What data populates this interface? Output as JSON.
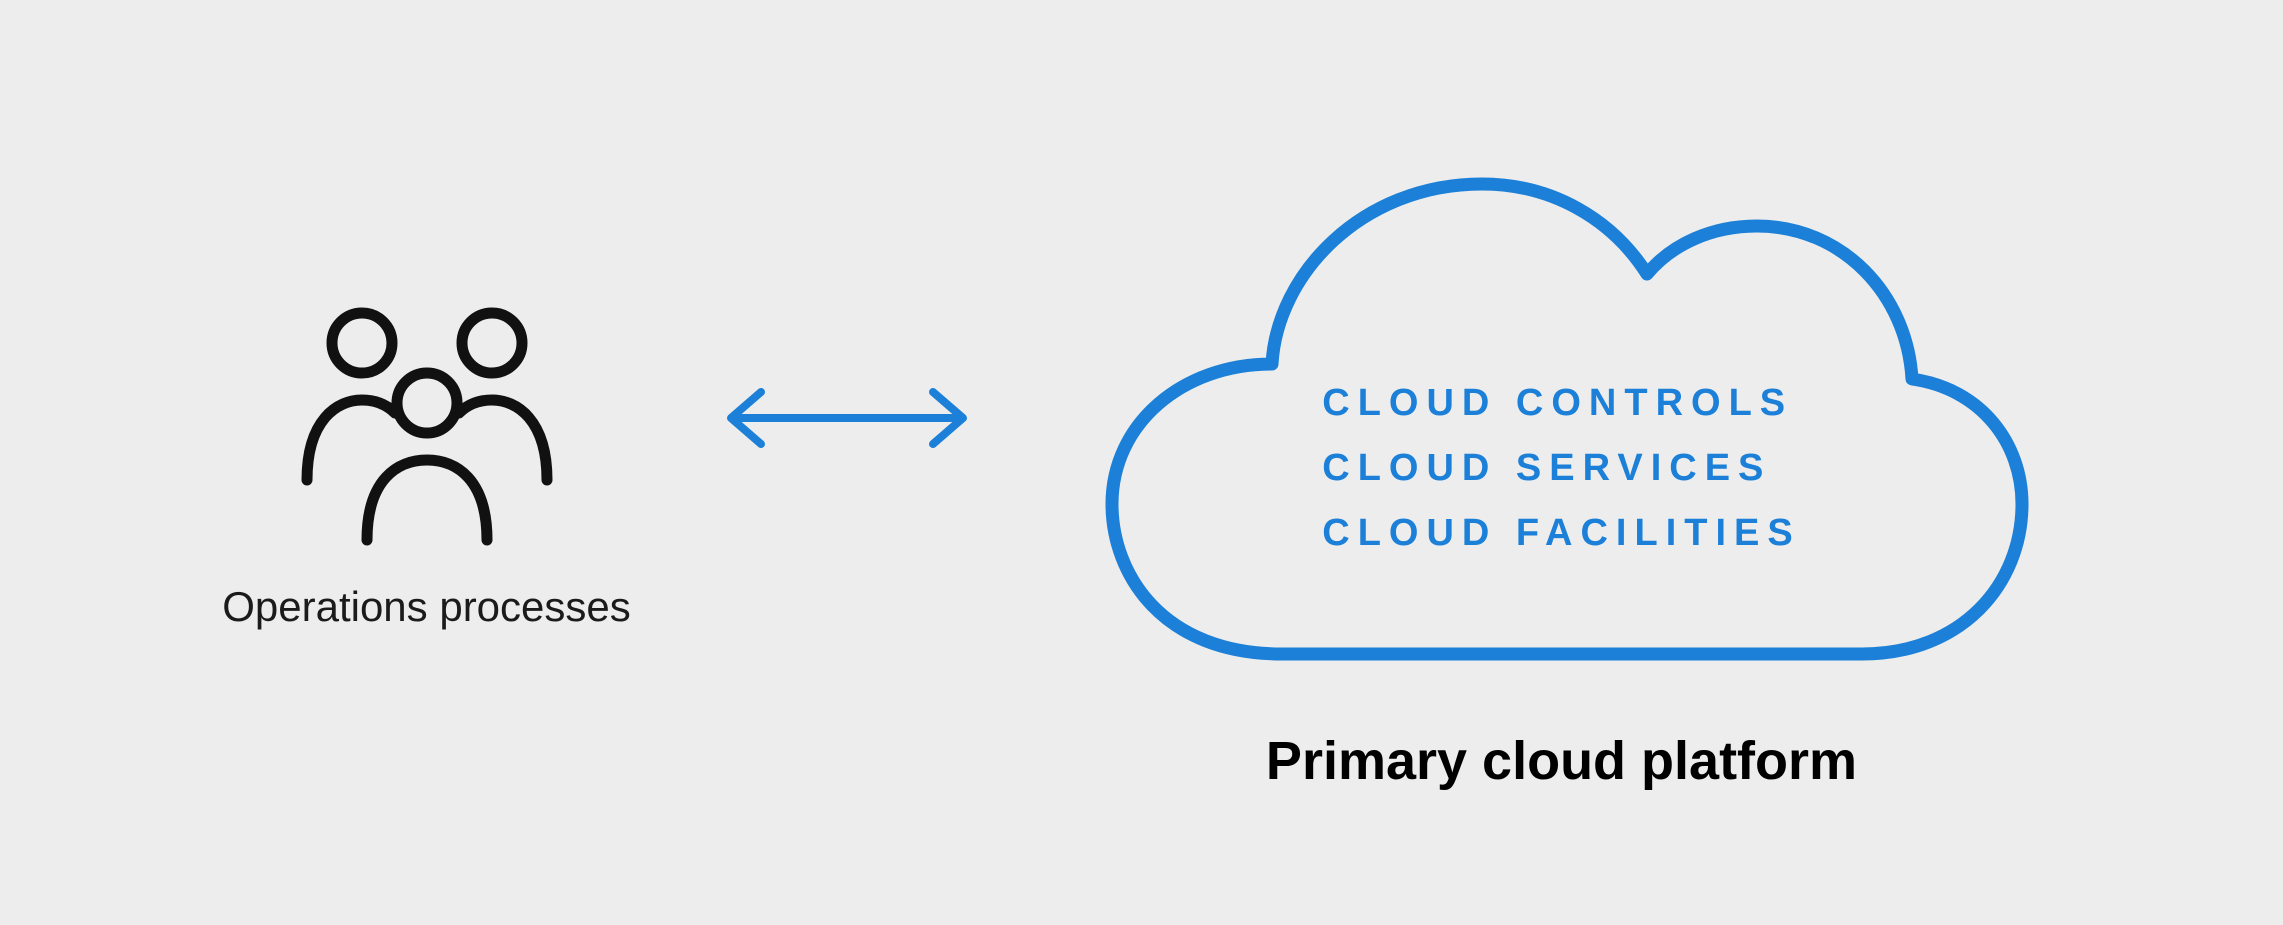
{
  "diagram": {
    "left": {
      "label": "Operations processes",
      "icon": "people-group-icon"
    },
    "connector": {
      "type": "bidirectional-arrow",
      "color": "#1c80d8"
    },
    "right": {
      "label": "Primary cloud platform",
      "icon": "cloud-icon",
      "items": [
        "CLOUD CONTROLS",
        "CLOUD SERVICES",
        "CLOUD FACILITIES"
      ]
    },
    "colors": {
      "accent": "#1c80d8",
      "text": "#1b1b1b",
      "bg": "#ededed",
      "outline": "#111"
    }
  }
}
